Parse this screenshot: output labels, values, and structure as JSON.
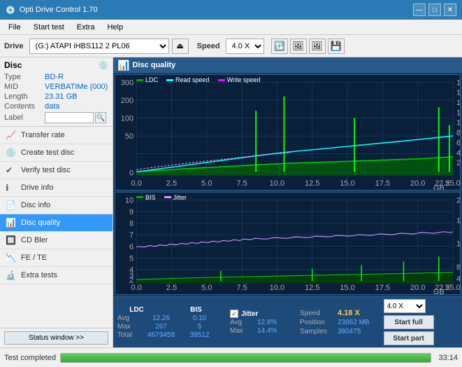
{
  "titlebar": {
    "title": "Opti Drive Control 1.70",
    "icon": "💿",
    "controls": [
      "—",
      "□",
      "✕"
    ]
  },
  "menubar": {
    "items": [
      "File",
      "Start test",
      "Extra",
      "Help"
    ]
  },
  "toolbar": {
    "drive_label": "Drive",
    "drive_value": "(G:) ATAPI iHBS112  2 PL06",
    "speed_label": "Speed",
    "speed_value": "4.0 X",
    "icons": [
      "🔃",
      "🖼️",
      "🖼️",
      "💾"
    ]
  },
  "disc": {
    "section_label": "Disc",
    "type_key": "Type",
    "type_val": "BD-R",
    "mid_key": "MID",
    "mid_val": "VERBATIMe (000)",
    "length_key": "Length",
    "length_val": "23.31 GB",
    "contents_key": "Contents",
    "contents_val": "data",
    "label_key": "Label",
    "label_placeholder": ""
  },
  "nav": {
    "items": [
      {
        "id": "transfer-rate",
        "label": "Transfer rate",
        "icon": "📈"
      },
      {
        "id": "create-test-disc",
        "label": "Create test disc",
        "icon": "💿"
      },
      {
        "id": "verify-test-disc",
        "label": "Verify test disc",
        "icon": "✔️"
      },
      {
        "id": "drive-info",
        "label": "Drive info",
        "icon": "ℹ️"
      },
      {
        "id": "disc-info",
        "label": "Disc info",
        "icon": "📄"
      },
      {
        "id": "disc-quality",
        "label": "Disc quality",
        "icon": "📊",
        "active": true
      },
      {
        "id": "cd-bler",
        "label": "CD Bler",
        "icon": "🔲"
      },
      {
        "id": "fe-te",
        "label": "FE / TE",
        "icon": "📉"
      },
      {
        "id": "extra-tests",
        "label": "Extra tests",
        "icon": "🔬"
      }
    ]
  },
  "disc_quality": {
    "header": "Disc quality",
    "legend": {
      "ldc": {
        "label": "LDC",
        "color": "#00aa00"
      },
      "read_speed": {
        "label": "Read speed",
        "color": "#00ffff"
      },
      "write_speed": {
        "label": "Write speed",
        "color": "#ff00ff"
      }
    },
    "legend2": {
      "bis": {
        "label": "BIS",
        "color": "#00aa00"
      },
      "jitter": {
        "label": "Jitter",
        "color": "#cc99ff"
      }
    }
  },
  "stats": {
    "columns": [
      "LDC",
      "BIS"
    ],
    "rows": [
      {
        "label": "Avg",
        "ldc": "12.26",
        "bis": "0.10"
      },
      {
        "label": "Max",
        "ldc": "267",
        "bis": "5"
      },
      {
        "label": "Total",
        "ldc": "4679458",
        "bis": "39512"
      }
    ],
    "jitter": {
      "label": "Jitter",
      "checked": true,
      "rows": [
        {
          "label": "Avg",
          "val": "12.8%"
        },
        {
          "label": "Max",
          "val": "14.4%"
        }
      ]
    },
    "speed": {
      "label": "Speed",
      "value": "4.18 X",
      "position_label": "Position",
      "position_val": "23862 MB",
      "samples_label": "Samples",
      "samples_val": "380475"
    },
    "speed_select": "4.0 X",
    "btn_start_full": "Start full",
    "btn_start_part": "Start part"
  },
  "statusbar": {
    "text": "Test completed",
    "progress": 100,
    "time": "33:14"
  }
}
